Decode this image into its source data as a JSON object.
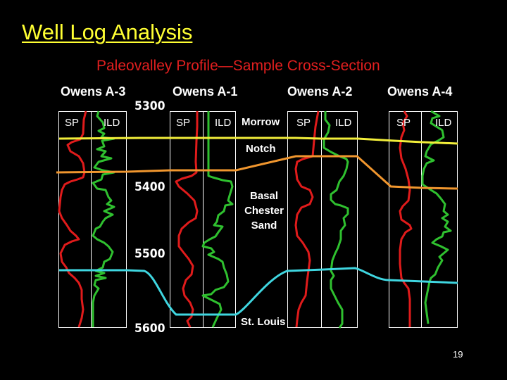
{
  "slide": {
    "title": "Well Log Analysis",
    "subtitle": "Paleovalley Profile—Sample Cross-Section",
    "page_number": "19"
  },
  "wells": [
    {
      "name": "Owens A-3",
      "tracks": [
        "SP",
        "ILD"
      ]
    },
    {
      "name": "Owens A-1",
      "tracks": [
        "SP",
        "ILD"
      ]
    },
    {
      "name": "Owens A-2",
      "tracks": [
        "SP",
        "ILD"
      ]
    },
    {
      "name": "Owens A-4",
      "tracks": [
        "SP",
        "ILD"
      ]
    }
  ],
  "depth_labels": [
    "5300",
    "5400",
    "5500",
    "5600"
  ],
  "formation_labels": {
    "morrow": "Morrow",
    "notch": "Notch",
    "basal_chester_sand": [
      "Basal",
      "Chester",
      "Sand"
    ],
    "st_louis": "St. Louis"
  },
  "colors": {
    "background": "#000000",
    "title": "#ffff33",
    "subtitle": "#e21f1f",
    "sp_curve": "#e01b1b",
    "ild_curve": "#2fc02f",
    "morrow_marker": "#f2ee3a",
    "notch_marker": "#f0962e",
    "st_louis_marker": "#3fd6e0",
    "track_border": "#ffffff"
  },
  "correlation_lines": [
    {
      "name": "Morrow",
      "color_key": "morrow_marker"
    },
    {
      "name": "Notch / Basal Chester",
      "color_key": "notch_marker"
    },
    {
      "name": "St. Louis",
      "color_key": "st_louis_marker"
    }
  ]
}
